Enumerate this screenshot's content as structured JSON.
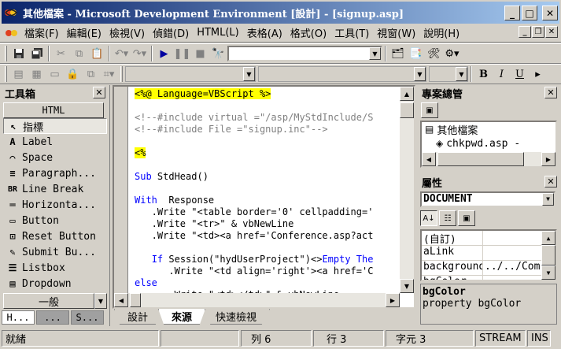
{
  "window": {
    "title": "其他檔案 - Microsoft Development Environment [設計] - [signup.asp]",
    "minimize": "_",
    "maximize": "□",
    "close": "✕"
  },
  "menu": {
    "items": [
      "檔案(F)",
      "編輯(E)",
      "檢視(V)",
      "偵錯(D)",
      "HTML(L)",
      "表格(A)",
      "格式(O)",
      "工具(T)",
      "視窗(W)",
      "說明(H)"
    ]
  },
  "toolbox": {
    "title": "工具箱",
    "tab": "HTML",
    "items": [
      {
        "icon": "pointer-icon",
        "glyph": "↖",
        "label": "指標"
      },
      {
        "icon": "label-icon",
        "glyph": "A",
        "label": "Label"
      },
      {
        "icon": "space-icon",
        "glyph": "⌒",
        "label": "Space"
      },
      {
        "icon": "paragraph-icon",
        "glyph": "≡",
        "label": "Paragraph..."
      },
      {
        "icon": "line-break-icon",
        "glyph": "BR",
        "label": "Line Break"
      },
      {
        "icon": "horizontal-rule-icon",
        "glyph": "═",
        "label": "Horizonta..."
      },
      {
        "icon": "button-icon",
        "glyph": "▭",
        "label": "Button"
      },
      {
        "icon": "reset-button-icon",
        "glyph": "⊡",
        "label": "Reset Button"
      },
      {
        "icon": "submit-button-icon",
        "glyph": "✎",
        "label": "Submit Bu..."
      },
      {
        "icon": "listbox-icon",
        "glyph": "☰",
        "label": "Listbox"
      },
      {
        "icon": "dropdown-icon",
        "glyph": "▤",
        "label": "Dropdown"
      }
    ],
    "general": "一般",
    "bottom_tabs": [
      "H...",
      "...",
      "S..."
    ]
  },
  "editor": {
    "lines": [
      {
        "segments": [
          {
            "t": "<%@ Language=VBScript %>",
            "c": "hl"
          }
        ]
      },
      {
        "segments": []
      },
      {
        "segments": [
          {
            "t": "<!--#include virtual =\"/asp/MyStdInclude/S",
            "c": "cm"
          }
        ]
      },
      {
        "segments": [
          {
            "t": "<!--#include File =\"signup.inc\"-->",
            "c": "cm"
          }
        ]
      },
      {
        "segments": []
      },
      {
        "segments": [
          {
            "t": "<%",
            "c": "hl"
          }
        ]
      },
      {
        "segments": []
      },
      {
        "segments": [
          {
            "t": "Sub",
            "c": "kw"
          },
          {
            "t": " StdHead()",
            "c": ""
          }
        ]
      },
      {
        "segments": []
      },
      {
        "segments": [
          {
            "t": "With",
            "c": "kw"
          },
          {
            "t": "  Response",
            "c": ""
          }
        ]
      },
      {
        "segments": [
          {
            "t": "   .Write \"<table border='0' cellpadding='",
            "c": ""
          }
        ]
      },
      {
        "segments": [
          {
            "t": "   .Write \"<tr>\" & vbNewLine",
            "c": ""
          }
        ]
      },
      {
        "segments": [
          {
            "t": "   .Write \"<td><a href='Conference.asp?act",
            "c": ""
          }
        ]
      },
      {
        "segments": []
      },
      {
        "segments": [
          {
            "t": "   ",
            "c": ""
          },
          {
            "t": "If",
            "c": "kw"
          },
          {
            "t": " Session(\"hydUserProject\")<>",
            "c": ""
          },
          {
            "t": "Empty",
            "c": "kw"
          },
          {
            "t": " The",
            "c": "kw"
          }
        ]
      },
      {
        "segments": [
          {
            "t": "      .Write \"<td align='right'><a href='C",
            "c": ""
          }
        ]
      },
      {
        "segments": [
          {
            "t": "else",
            "c": "kw"
          }
        ]
      },
      {
        "segments": [
          {
            "t": "      .Write \"<td></td>\" & vbNewLine",
            "c": ""
          }
        ]
      }
    ],
    "view_tabs": [
      "設計",
      "來源",
      "快速檢視"
    ],
    "active_tab": 1
  },
  "project": {
    "title": "專案總管",
    "root": "其他檔案",
    "child": "chkpwd.asp -"
  },
  "properties": {
    "title": "屬性",
    "object": "DOCUMENT",
    "rows": [
      {
        "name": "(自訂)",
        "value": ""
      },
      {
        "name": "aLink",
        "value": ""
      },
      {
        "name": "background",
        "value": "../../Com"
      },
      {
        "name": "bgColor",
        "value": ""
      }
    ],
    "desc_title": "bgColor",
    "desc_text": "property bgColor"
  },
  "status": {
    "ready": "就緒",
    "line": "列 6",
    "col": "行 3",
    "char": "字元 3",
    "mode": "STREAM",
    "ins": "INS"
  }
}
